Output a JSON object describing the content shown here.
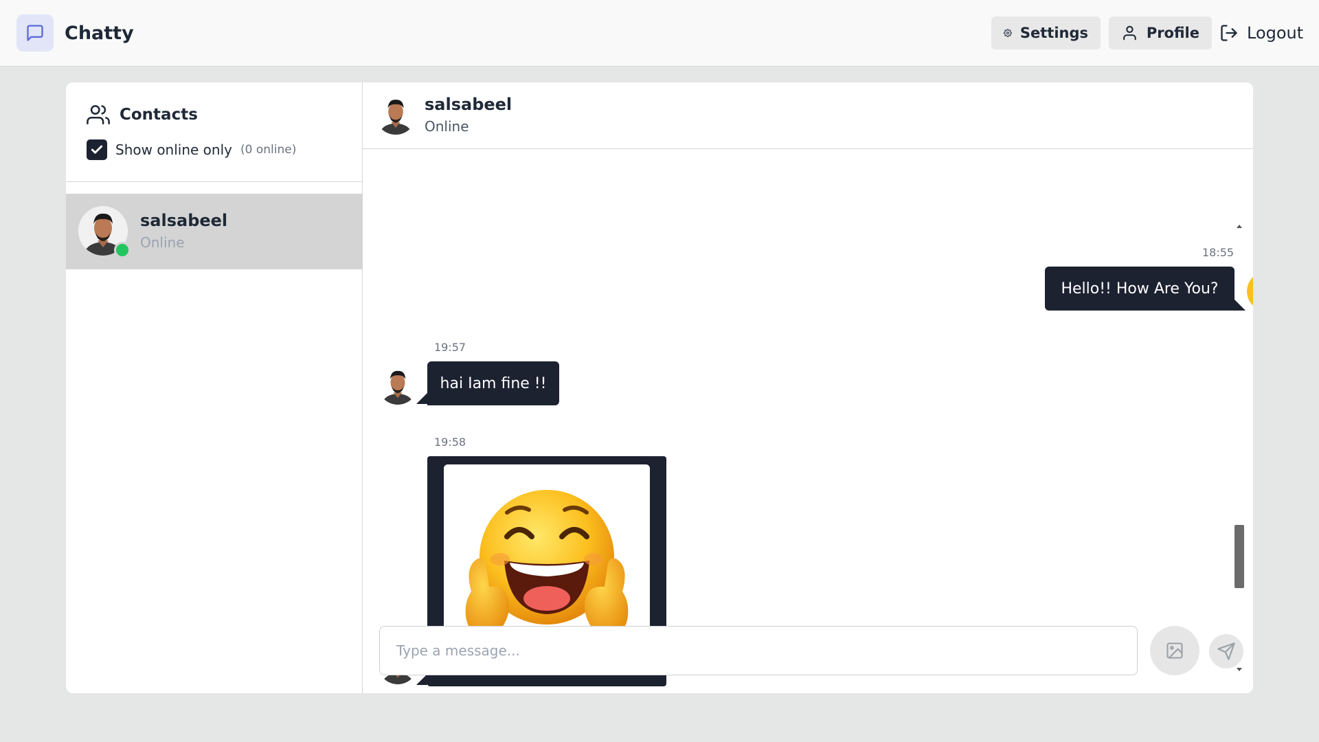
{
  "app": {
    "name": "Chatty",
    "logo_icon": "message-square-icon",
    "accent": "#5b6bd8"
  },
  "nav": {
    "settings_label": "Settings",
    "profile_label": "Profile",
    "logout_label": "Logout"
  },
  "sidebar": {
    "title": "Contacts",
    "filter_label": "Show online only",
    "filter_checked": true,
    "online_count": "(0 online)",
    "contacts": [
      {
        "name": "salsabeel",
        "status": "Online",
        "selected": true,
        "online": true
      }
    ]
  },
  "chat": {
    "name": "salsabeel",
    "status": "Online",
    "messages": [
      {
        "direction": "out",
        "time": "18:55",
        "text": "Hello!! How Are You?"
      },
      {
        "direction": "in",
        "time": "19:57",
        "text": "hai Iam fine !!"
      },
      {
        "direction": "in",
        "time": "19:58",
        "image": "laughing-thumbs-up-emoji"
      }
    ]
  },
  "composer": {
    "placeholder": "Type a message..."
  },
  "colors": {
    "bubble": "#1d2231",
    "online_dot": "#22c55e",
    "selected_contact": "#d4d4d4"
  }
}
